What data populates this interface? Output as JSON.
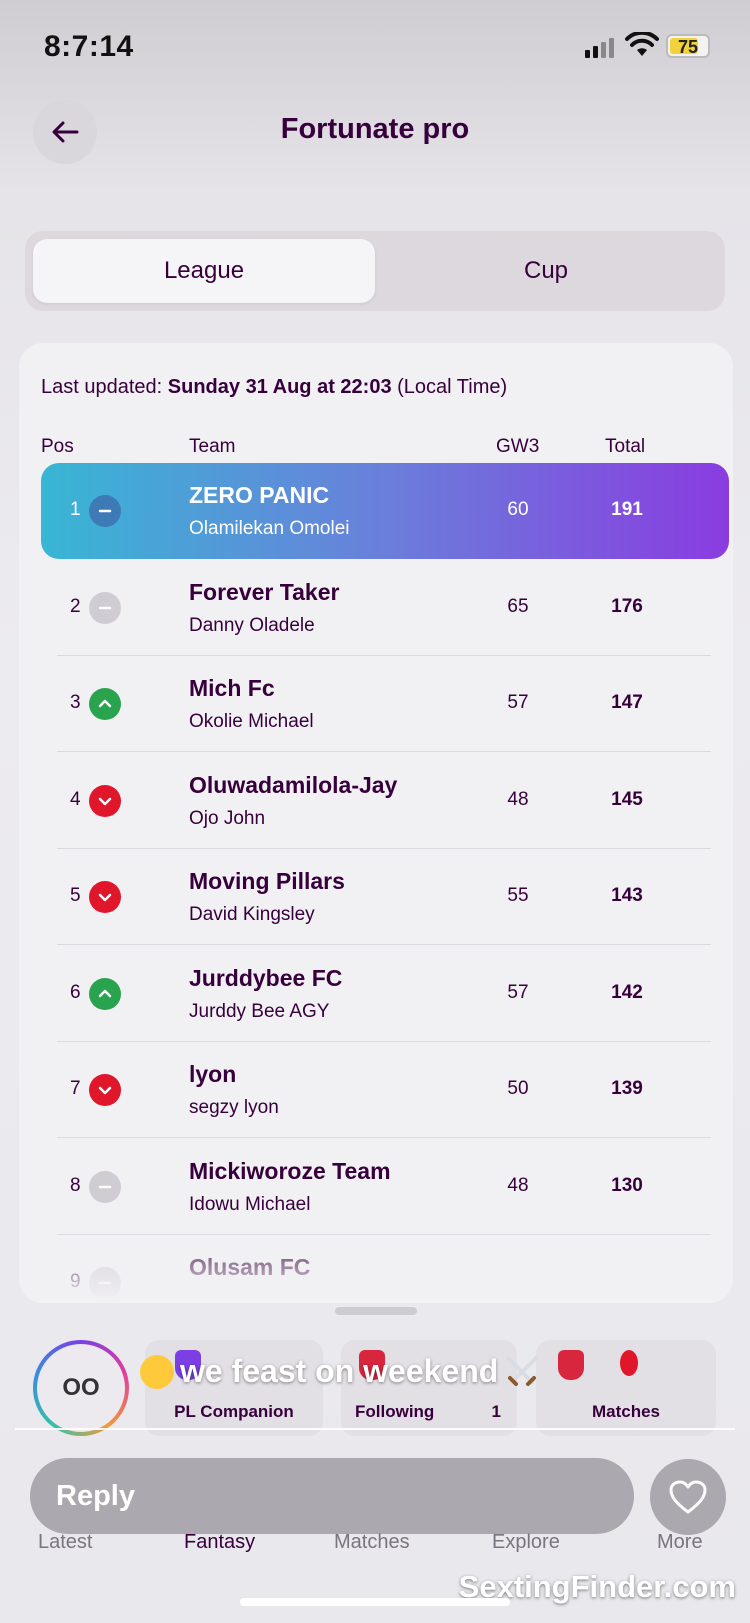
{
  "status_bar": {
    "time": "8:7:14",
    "battery": "75"
  },
  "header": {
    "title": "Fortunate pro"
  },
  "segment": {
    "tabs": [
      "League",
      "Cup"
    ],
    "active": "League"
  },
  "league": {
    "updated_prefix": "Last updated:",
    "updated_value": "Sunday 31 Aug at 22:03",
    "updated_suffix": "(Local Time)",
    "columns": {
      "pos": "Pos",
      "team": "Team",
      "gw": "GW3",
      "total": "Total"
    },
    "rows": [
      {
        "pos": "1",
        "movement": "same",
        "team": "ZERO PANIC",
        "manager": "Olamilekan Omolei",
        "gw": "60",
        "total": "191"
      },
      {
        "pos": "2",
        "movement": "same",
        "team": "Forever Taker",
        "manager": "Danny Oladele",
        "gw": "65",
        "total": "176"
      },
      {
        "pos": "3",
        "movement": "up",
        "team": "Mich Fc",
        "manager": "Okolie Michael",
        "gw": "57",
        "total": "147"
      },
      {
        "pos": "4",
        "movement": "down",
        "team": "Oluwadamilola-Jay",
        "manager": "Ojo John",
        "gw": "48",
        "total": "145"
      },
      {
        "pos": "5",
        "movement": "down",
        "team": "Moving Pillars",
        "manager": "David Kingsley",
        "gw": "55",
        "total": "143"
      },
      {
        "pos": "6",
        "movement": "up",
        "team": "Jurddybee FC",
        "manager": "Jurddy Bee AGY",
        "gw": "57",
        "total": "142"
      },
      {
        "pos": "7",
        "movement": "down",
        "team": "lyon",
        "manager": "segzy lyon",
        "gw": "50",
        "total": "139"
      },
      {
        "pos": "8",
        "movement": "same",
        "team": "Mickiworoze Team",
        "manager": "Idowu Michael",
        "gw": "48",
        "total": "130"
      },
      {
        "pos": "9",
        "movement": "same",
        "team": "Olusam FC",
        "manager": "",
        "gw": "",
        "total": ""
      }
    ]
  },
  "shortcuts": {
    "avatar_text": "OO",
    "pl_companion": "PL Companion",
    "following": "Following",
    "following_count": "1",
    "matches": "Matches"
  },
  "story": {
    "caption": "we feast on weekend",
    "reply_label": "Reply"
  },
  "tab_bar": [
    "Latest",
    "Fantasy",
    "Matches",
    "Explore",
    "More"
  ],
  "watermark": "SextingFinder.com",
  "colors": {
    "primary": "#37003c",
    "highlight_start": "#38b6d4",
    "highlight_end": "#8a3ce0",
    "up": "#2aa34f",
    "down": "#e0162b",
    "same": "#d0ccd3"
  }
}
